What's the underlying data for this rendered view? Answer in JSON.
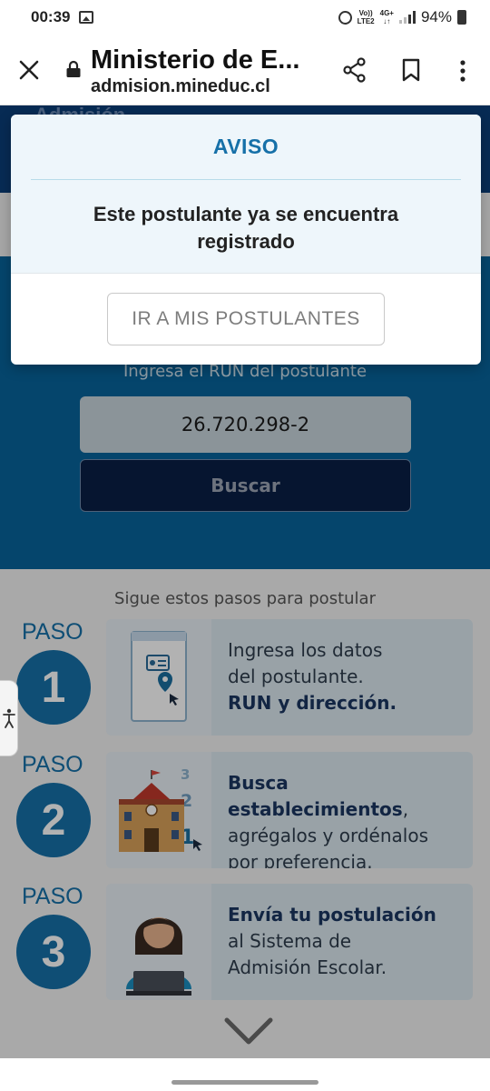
{
  "status_bar": {
    "time": "00:39",
    "network_top": "Vo))",
    "network_bottom": "LTE2",
    "data_top": "4G+",
    "data_bottom": "↓↑",
    "battery": "94%"
  },
  "browser": {
    "title": "Ministerio de E...",
    "url": "admision.mineduc.cl"
  },
  "page": {
    "header_partial": "Admisión",
    "run_label": "Ingresa el RUN del postulante",
    "run_value": "26.720.298-2",
    "search_label": "Buscar",
    "steps_title": "Sigue estos pasos para postular",
    "steps": [
      {
        "paso": "PASO",
        "number": "1",
        "line1": "Ingresa los datos",
        "line2": "del postulante.",
        "line3_bold": "RUN y dirección."
      },
      {
        "paso": "PASO",
        "number": "2",
        "line1_bold": "Busca establecimientos",
        "line1_rest": ",",
        "line2": "agrégalos y ordénalos",
        "line3": "por preferencia."
      },
      {
        "paso": "PASO",
        "number": "3",
        "line1_bold": "Envía tu postulación",
        "line2": "al Sistema de",
        "line3": "Admisión Escolar."
      }
    ],
    "step2_numbers": [
      "3",
      "2",
      "1"
    ]
  },
  "modal": {
    "title": "AVISO",
    "message": "Este postulante ya se encuentra registrado",
    "button_label": "IR A MIS POSTULANTES"
  },
  "colors": {
    "primary_blue": "#1670a8",
    "hero_blue": "#08649b",
    "dark_navy": "#0a1f45"
  }
}
